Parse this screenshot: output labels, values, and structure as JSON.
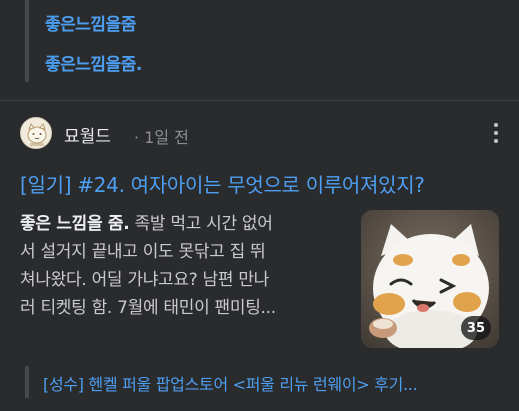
{
  "top_quote": {
    "links": [
      "좋은느낌을줌",
      "좋은느낌을줌."
    ]
  },
  "post": {
    "author": "묘월드",
    "time": "· 1일 전",
    "title": "[일기] #24. 여자아이는 무엇으로 이루어져있지?",
    "body_lead": "좋은 느낌을 줌.",
    "body_lines": [
      " 족발 먹고 시간 없어",
      "서 설거지 끝내고 이도 못닦고 집 뛰",
      "쳐나왔다. 어딜 가냐고요? 남편 만나",
      "러 티켓팅 함. 7월에 태민이 팬미팅..."
    ],
    "image_count": "35"
  },
  "bottom_quote": {
    "link": "[성수] 헨켈 퍼울 팝업스토어 <퍼울 리뉴 런웨이> 후기..."
  },
  "colors": {
    "background": "#2a2b2d",
    "link": "#4d9ff2",
    "quote_bar": "#46484b"
  },
  "icons": {
    "more": "more-vertical-icon",
    "avatar": "cat-logo-avatar"
  }
}
